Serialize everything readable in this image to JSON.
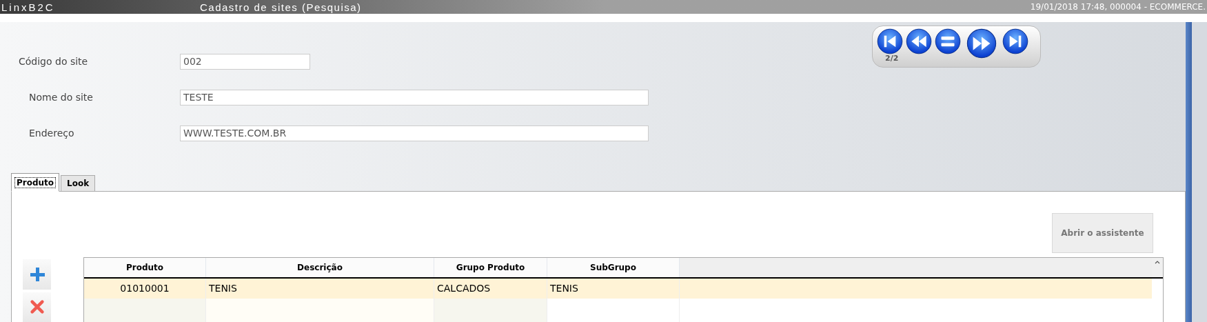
{
  "title_bar": {
    "app": "LinxB2C",
    "title": "Cadastro de sites (Pesquisa)",
    "info": "19/01/2018 17:48, 000004 - ECOMMERCE."
  },
  "fields": [
    {
      "label": "Código do site",
      "value": "002",
      "kind": "short"
    },
    {
      "label": "Nome do site",
      "value": "TESTE",
      "kind": "long"
    },
    {
      "label": "Endereço",
      "value": "WWW.TESTE.COM.BR",
      "kind": "long"
    }
  ],
  "navigator": {
    "position": "2/2",
    "buttons": [
      {
        "kind": "first"
      },
      {
        "kind": "previous"
      },
      {
        "kind": "list"
      },
      {
        "kind": "next"
      },
      {
        "kind": "last"
      }
    ]
  },
  "tabs": [
    {
      "label": "Produto",
      "selected": true
    },
    {
      "label": "Look",
      "selected": false
    }
  ],
  "wizard_button": "Abrir o assistente",
  "side_buttons": [
    {
      "kind": "add"
    },
    {
      "kind": "delete"
    }
  ],
  "table": {
    "columns": [
      "Produto",
      "Descrição",
      "Grupo Produto",
      "SubGrupo"
    ],
    "rows": [
      {
        "cells": [
          "01010001",
          "TENIS",
          "CALCADOS",
          "TENIS"
        ],
        "selected": true
      }
    ]
  }
}
